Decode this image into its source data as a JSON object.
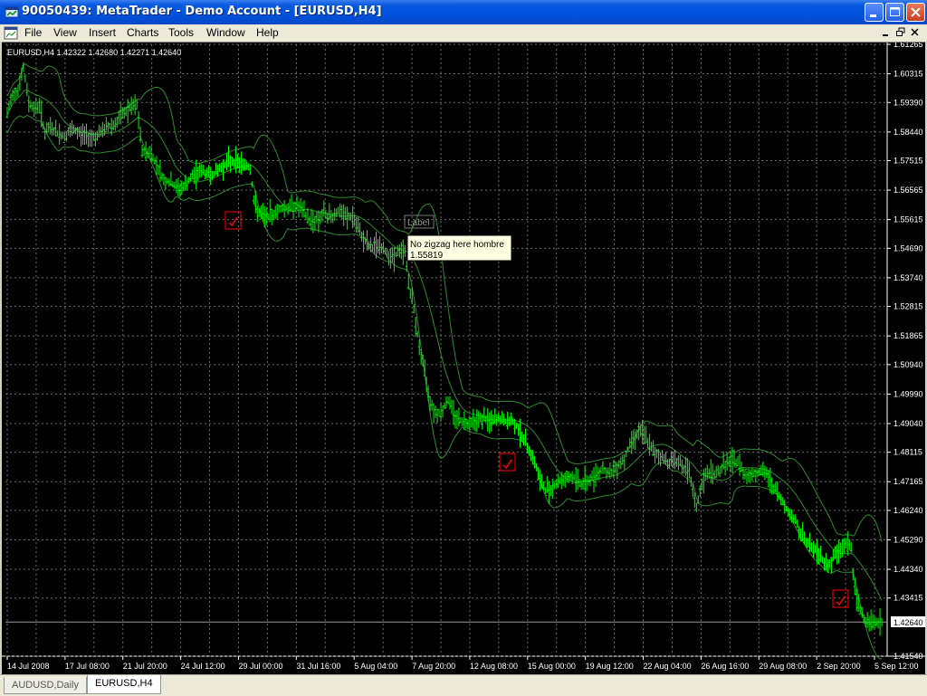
{
  "window": {
    "title": "90050439: MetaTrader - Demo Account - [EURUSD,H4]",
    "menu": [
      "File",
      "View",
      "Insert",
      "Charts",
      "Tools",
      "Window",
      "Help"
    ]
  },
  "chart_data": {
    "type": "bar",
    "symbol_line": "EURUSD,H4  1.42322 1.42680 1.42271 1.42640",
    "current_price": "1.42640",
    "price_axis_labels": [
      "1.61265",
      "1.60315",
      "1.59390",
      "1.58440",
      "1.57515",
      "1.56565",
      "1.55615",
      "1.54690",
      "1.53740",
      "1.52815",
      "1.51865",
      "1.50940",
      "1.49990",
      "1.49040",
      "1.48115",
      "1.47165",
      "1.46240",
      "1.45290",
      "1.44340",
      "1.43415",
      "1.42640",
      "1.41540"
    ],
    "time_axis_labels": [
      "14 Jul 2008",
      "17 Jul 08:00",
      "21 Jul 20:00",
      "24 Jul 12:00",
      "29 Jul 00:00",
      "31 Jul 16:00",
      "5 Aug 04:00",
      "7 Aug 20:00",
      "12 Aug 08:00",
      "15 Aug 00:00",
      "19 Aug 12:00",
      "22 Aug 04:00",
      "26 Aug 16:00",
      "29 Aug 08:00",
      "2 Sep 20:00",
      "5 Sep 12:00"
    ],
    "ylim": [
      1.4154,
      1.61265
    ],
    "grid": true,
    "bar_color": "#00ff00",
    "band_color": "#2e8b2e",
    "price_series": [
      [
        0,
        1.59
      ],
      [
        6,
        1.597
      ],
      [
        12,
        1.598
      ],
      [
        18,
        1.605
      ],
      [
        24,
        1.594
      ],
      [
        30,
        1.592
      ],
      [
        36,
        1.593
      ],
      [
        42,
        1.584
      ],
      [
        48,
        1.586
      ],
      [
        56,
        1.584
      ],
      [
        64,
        1.583
      ],
      [
        72,
        1.585
      ],
      [
        80,
        1.584
      ],
      [
        90,
        1.583
      ],
      [
        100,
        1.583
      ],
      [
        110,
        1.586
      ],
      [
        120,
        1.587
      ],
      [
        128,
        1.59
      ],
      [
        136,
        1.592
      ],
      [
        144,
        1.593
      ],
      [
        150,
        1.578
      ],
      [
        158,
        1.578
      ],
      [
        166,
        1.574
      ],
      [
        174,
        1.569
      ],
      [
        182,
        1.568
      ],
      [
        190,
        1.566
      ],
      [
        198,
        1.567
      ],
      [
        206,
        1.57
      ],
      [
        214,
        1.572
      ],
      [
        222,
        1.571
      ],
      [
        230,
        1.571
      ],
      [
        238,
        1.573
      ],
      [
        246,
        1.575
      ],
      [
        254,
        1.575
      ],
      [
        262,
        1.574
      ],
      [
        270,
        1.573
      ],
      [
        274,
        1.562
      ],
      [
        280,
        1.558
      ],
      [
        288,
        1.557
      ],
      [
        296,
        1.558
      ],
      [
        304,
        1.56
      ],
      [
        312,
        1.56
      ],
      [
        320,
        1.561
      ],
      [
        328,
        1.559
      ],
      [
        336,
        1.556
      ],
      [
        344,
        1.556
      ],
      [
        352,
        1.558
      ],
      [
        360,
        1.557
      ],
      [
        368,
        1.559
      ],
      [
        376,
        1.557
      ],
      [
        384,
        1.557
      ],
      [
        390,
        1.553
      ],
      [
        396,
        1.55
      ],
      [
        404,
        1.547
      ],
      [
        412,
        1.548
      ],
      [
        420,
        1.546
      ],
      [
        428,
        1.544
      ],
      [
        436,
        1.546
      ],
      [
        442,
        1.546
      ],
      [
        446,
        1.536
      ],
      [
        452,
        1.527
      ],
      [
        458,
        1.515
      ],
      [
        464,
        1.507
      ],
      [
        470,
        1.498
      ],
      [
        476,
        1.494
      ],
      [
        482,
        1.494
      ],
      [
        490,
        1.498
      ],
      [
        498,
        1.493
      ],
      [
        506,
        1.491
      ],
      [
        514,
        1.491
      ],
      [
        522,
        1.492
      ],
      [
        530,
        1.492
      ],
      [
        538,
        1.491
      ],
      [
        546,
        1.492
      ],
      [
        554,
        1.491
      ],
      [
        562,
        1.491
      ],
      [
        568,
        1.489
      ],
      [
        574,
        1.485
      ],
      [
        580,
        1.482
      ],
      [
        586,
        1.478
      ],
      [
        592,
        1.472
      ],
      [
        598,
        1.469
      ],
      [
        606,
        1.47
      ],
      [
        614,
        1.472
      ],
      [
        622,
        1.473
      ],
      [
        630,
        1.473
      ],
      [
        638,
        1.471
      ],
      [
        646,
        1.472
      ],
      [
        654,
        1.474
      ],
      [
        662,
        1.476
      ],
      [
        670,
        1.474
      ],
      [
        678,
        1.477
      ],
      [
        686,
        1.479
      ],
      [
        694,
        1.485
      ],
      [
        702,
        1.488
      ],
      [
        710,
        1.486
      ],
      [
        718,
        1.481
      ],
      [
        726,
        1.48
      ],
      [
        734,
        1.478
      ],
      [
        742,
        1.479
      ],
      [
        750,
        1.477
      ],
      [
        758,
        1.474
      ],
      [
        766,
        1.463
      ],
      [
        772,
        1.471
      ],
      [
        780,
        1.475
      ],
      [
        788,
        1.474
      ],
      [
        796,
        1.477
      ],
      [
        804,
        1.478
      ],
      [
        812,
        1.478
      ],
      [
        820,
        1.474
      ],
      [
        828,
        1.474
      ],
      [
        836,
        1.475
      ],
      [
        844,
        1.474
      ],
      [
        852,
        1.47
      ],
      [
        860,
        1.466
      ],
      [
        868,
        1.462
      ],
      [
        876,
        1.459
      ],
      [
        884,
        1.454
      ],
      [
        892,
        1.451
      ],
      [
        900,
        1.449
      ],
      [
        908,
        1.446
      ],
      [
        914,
        1.445
      ],
      [
        920,
        1.448
      ],
      [
        926,
        1.45
      ],
      [
        932,
        1.452
      ],
      [
        938,
        1.45
      ],
      [
        942,
        1.436
      ],
      [
        948,
        1.43
      ],
      [
        954,
        1.427
      ],
      [
        960,
        1.427
      ],
      [
        966,
        1.426
      ],
      [
        972,
        1.4264
      ]
    ],
    "indicator": "Bollinger Bands",
    "labels": {
      "object_label": "Label",
      "tooltip_line1": "No zigzag here hombre",
      "tooltip_line2": "1.55819"
    }
  },
  "tabs": [
    {
      "label": "AUDUSD,Daily",
      "active": false
    },
    {
      "label": "EURUSD,H4",
      "active": true
    }
  ]
}
